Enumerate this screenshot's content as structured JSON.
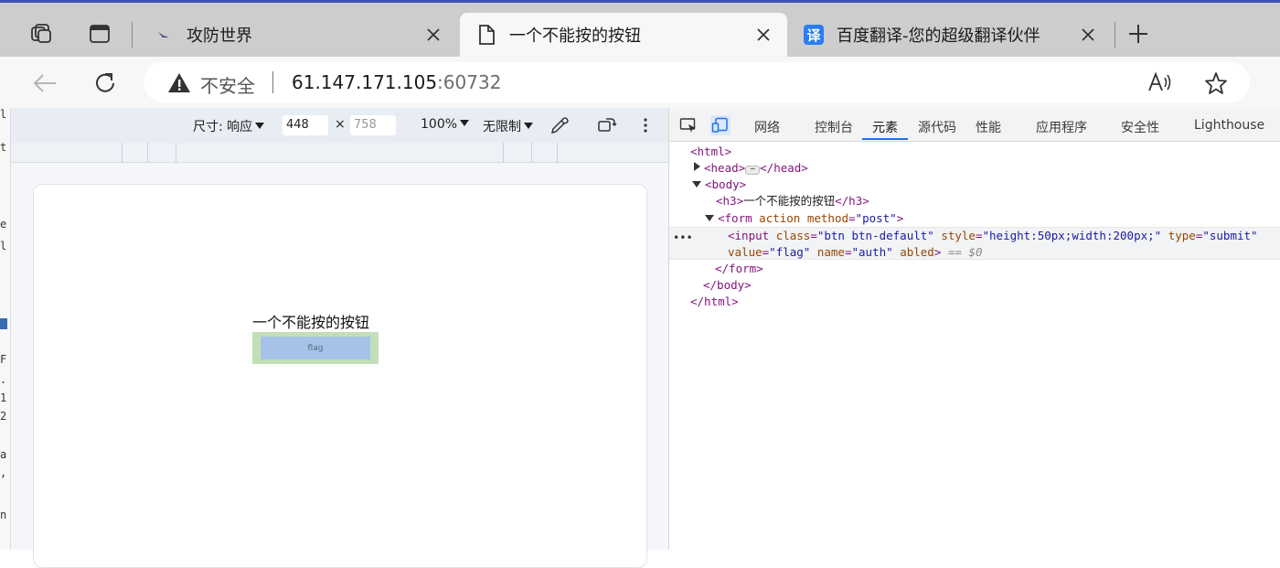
{
  "browser": {
    "tabs": [
      {
        "title": "攻防世界",
        "active": false
      },
      {
        "title": "一个不能按的按钮",
        "active": true
      },
      {
        "title": "百度翻译-您的超级翻译伙伴",
        "active": false,
        "favicon_text": "译"
      }
    ],
    "address": {
      "security_label": "不安全",
      "host": "61.147.171.105",
      "port": ":60732"
    }
  },
  "device_toolbar": {
    "dimensions_label": "尺寸: 响应",
    "width": "448",
    "times": "×",
    "height_placeholder": "758",
    "zoom": "100%",
    "throttle": "无限制"
  },
  "page": {
    "heading": "一个不能按的按钮",
    "button_value": "flag"
  },
  "devtools": {
    "tabs": [
      "网络",
      "控制台",
      "元素",
      "源代码",
      "性能",
      "应用程序",
      "安全性",
      "Lighthouse"
    ],
    "active_tab": "元素",
    "dom": {
      "html_open": "<html>",
      "head_open": "<head>",
      "head_close": "</head>",
      "body_open": "<body>",
      "h3_open": "<h3>",
      "h3_text": "一个不能按的按钮",
      "h3_close": "</h3>",
      "form_tag": "<form",
      "form_attr1": "action",
      "form_attr2": "method",
      "form_attr2_val": "\"post\"",
      "form_end": ">",
      "input_tag": "<input",
      "input_class_attr": "class",
      "input_class_val": "\"btn btn-default\"",
      "input_style_attr": "style",
      "input_style_val": "\"height:50px;width:200px;\"",
      "input_type_attr": "type",
      "input_type_val": "\"submit\"",
      "input_value_attr": "value",
      "input_value_val": "\"flag\"",
      "input_name_attr": "name",
      "input_name_val": "\"auth\"",
      "input_abled_attr": "abled",
      "input_end": ">",
      "selected_ref": "== $0",
      "form_close": "</form>",
      "body_close": "</body>",
      "html_close": "</html>"
    }
  }
}
